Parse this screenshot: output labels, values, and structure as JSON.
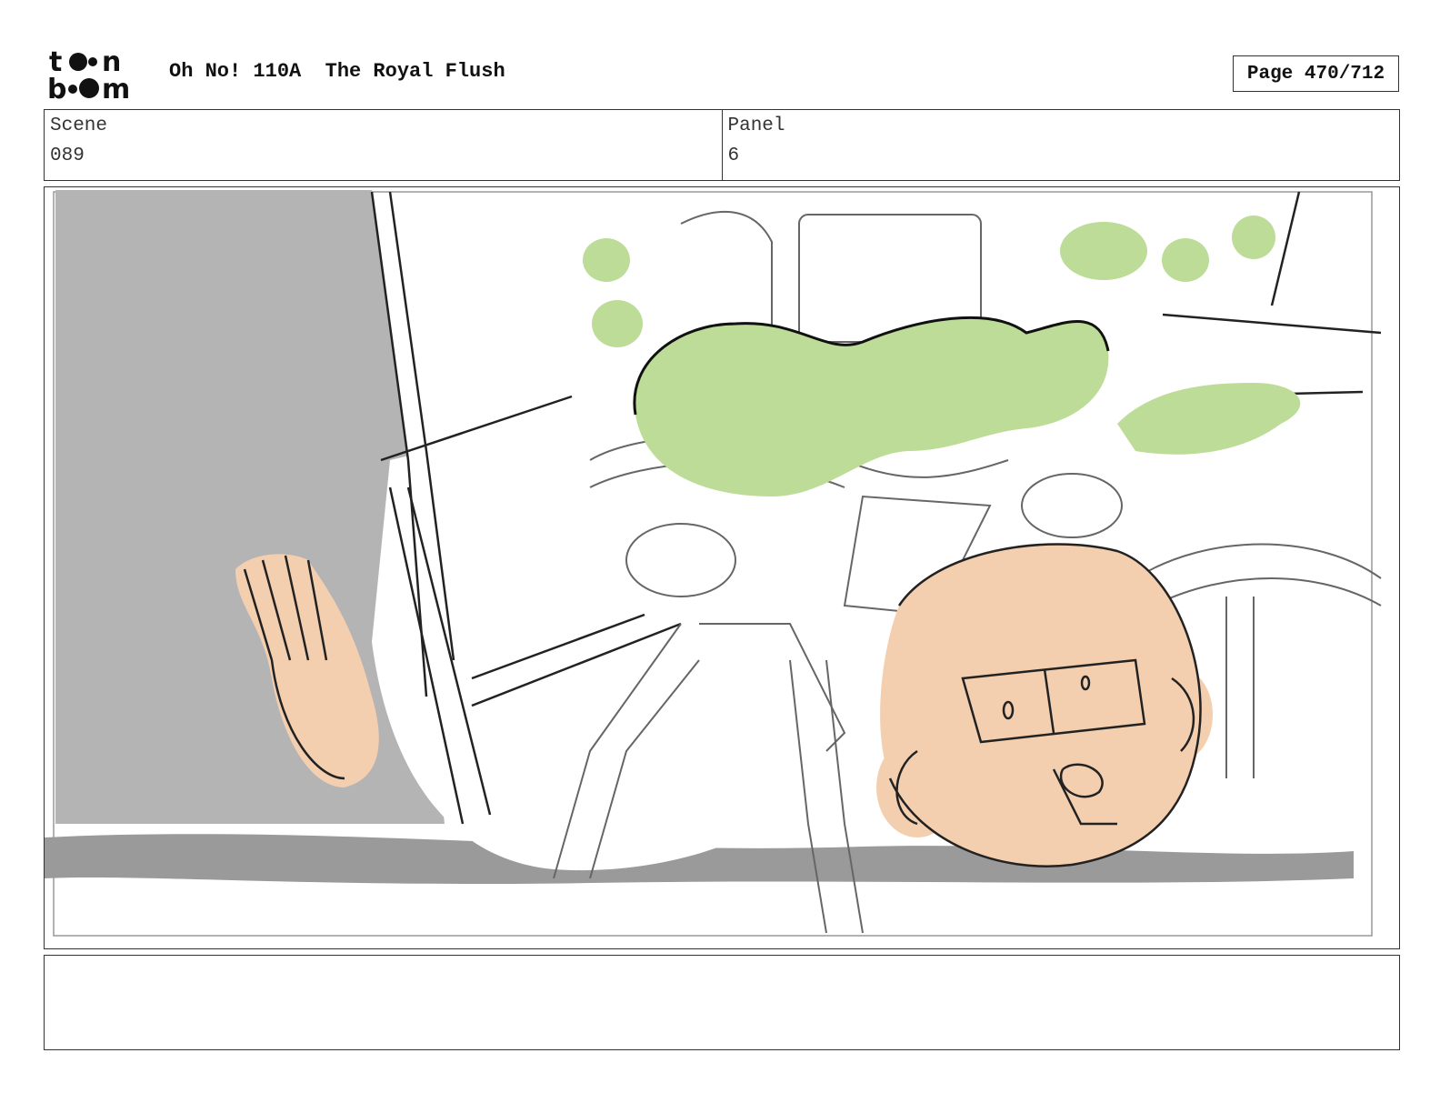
{
  "header": {
    "logo_text": "toon boom",
    "title": "Oh No! 110A  The Royal Flush",
    "page_label": "Page 470/712"
  },
  "info": {
    "scene_label": "Scene",
    "scene_value": "089",
    "panel_label": "Panel",
    "panel_value": "6"
  },
  "notes": {
    "text": ""
  },
  "colors": {
    "skin": "#f3cfb0",
    "slime": "#bddc97",
    "shadow_gray": "#b4b4b4",
    "floor_gray": "#9a9a9a"
  }
}
